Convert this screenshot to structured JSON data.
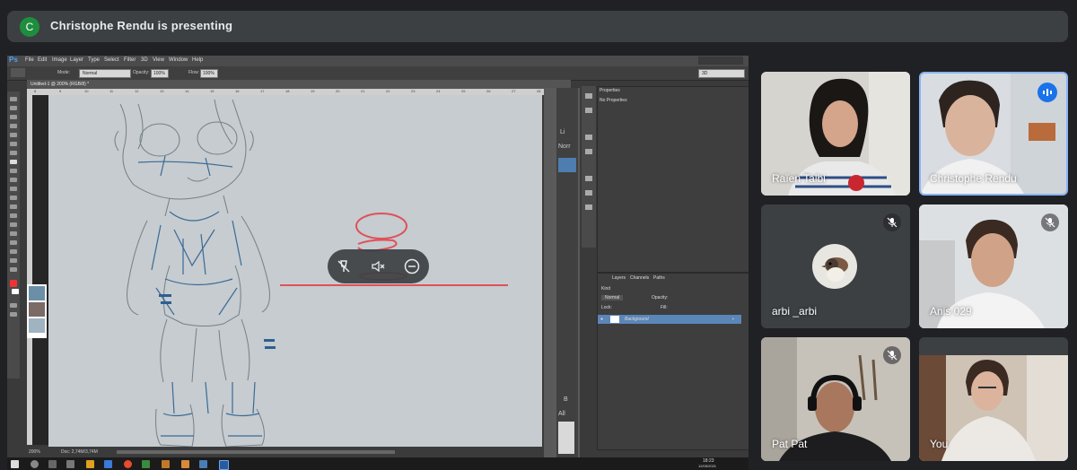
{
  "presenter_bar": {
    "avatar_letter": "C",
    "text": "Christophe Rendu is presenting"
  },
  "photoshop": {
    "logo": "Ps",
    "menu": [
      "File",
      "Edit",
      "Image",
      "Layer",
      "Type",
      "Select",
      "Filter",
      "3D",
      "View",
      "Window",
      "Help"
    ],
    "options": {
      "mode_label": "Mode:",
      "mode_value": "Normal",
      "opacity_label": "Opacity:",
      "opacity_value": "100%",
      "flow_label": "Flow:",
      "flow_value": "100%",
      "workspace_value": "3D"
    },
    "doc_tab": "Untitled-1 @ 200% (RGB/8) *",
    "ruler_numbers": [
      "8",
      "9",
      "10",
      "11",
      "12",
      "13",
      "14",
      "15",
      "16",
      "17",
      "18",
      "19",
      "20",
      "21",
      "22",
      "23",
      "24",
      "25",
      "26",
      "27",
      "28"
    ],
    "status": {
      "zoom": "200%",
      "doc": "Doc: 2,74M/3,74M"
    },
    "properties": {
      "tab": "Properties",
      "subtitle": "No Properties"
    },
    "layers": {
      "tabs": [
        "Layers",
        "Channels",
        "Paths"
      ],
      "kind_label": "Kind",
      "blend_value": "Normal",
      "opacity_label": "Opacity:",
      "lock_label": "Lock:",
      "fill_label": "Fill:",
      "layer_name": "Background"
    },
    "mid_panel_labels": {
      "top": "Li",
      "blend": "Norr",
      "bottom": "B",
      "all": "All"
    },
    "taskbar_time": "18:23",
    "taskbar_date": "12/05/2021"
  },
  "floating_controls": [
    "mute-presenter-icon",
    "volume-off-icon",
    "minimize-icon"
  ],
  "participants": [
    {
      "name": "Raïen Talbi",
      "muted": false,
      "speaking": false
    },
    {
      "name": "Christophe Rendu",
      "muted": false,
      "speaking": true
    },
    {
      "name": "arbi _arbi",
      "muted": true,
      "speaking": false
    },
    {
      "name": "Anis 029",
      "muted": true,
      "speaking": false
    },
    {
      "name": "Pat Pat",
      "muted": true,
      "speaking": false
    },
    {
      "name": "You",
      "muted": false,
      "speaking": false
    }
  ],
  "colors": {
    "background": "#202124",
    "speaking": "#1a73e8",
    "red_stroke": "#e0505a",
    "sketch_blue": "#2d5f92"
  }
}
